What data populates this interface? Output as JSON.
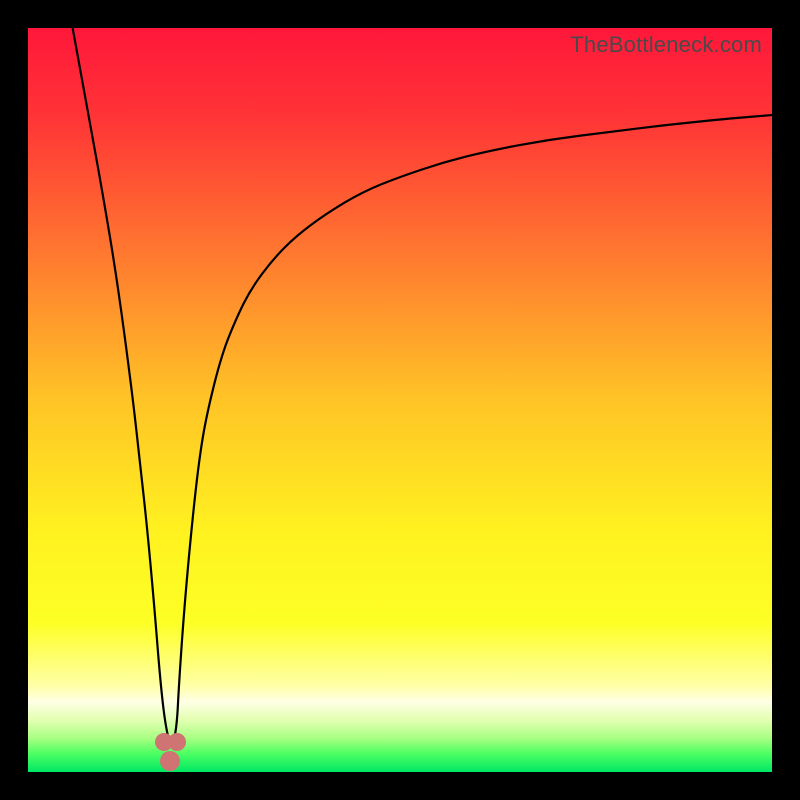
{
  "watermark": "TheBottleneck.com",
  "chart_data": {
    "type": "line",
    "title": "",
    "xlabel": "",
    "ylabel": "",
    "xlim": [
      0,
      100
    ],
    "ylim": [
      0,
      100
    ],
    "axes_visible": false,
    "background_gradient": {
      "stops": [
        {
          "pos": 0.0,
          "color": "#ff173a"
        },
        {
          "pos": 0.12,
          "color": "#ff3436"
        },
        {
          "pos": 0.3,
          "color": "#ff7730"
        },
        {
          "pos": 0.5,
          "color": "#ffc426"
        },
        {
          "pos": 0.68,
          "color": "#fff220"
        },
        {
          "pos": 0.8,
          "color": "#fdff25"
        },
        {
          "pos": 0.885,
          "color": "#ffffa9"
        },
        {
          "pos": 0.905,
          "color": "#ffffe6"
        },
        {
          "pos": 0.93,
          "color": "#e3ffb1"
        },
        {
          "pos": 0.955,
          "color": "#a7ff82"
        },
        {
          "pos": 0.975,
          "color": "#4dff62"
        },
        {
          "pos": 1.0,
          "color": "#00e765"
        }
      ]
    },
    "series": [
      {
        "name": "bottleneck-curve",
        "stroke": "#000000",
        "stroke_width": 2.2,
        "x": [
          6,
          8,
          10,
          12,
          14,
          15,
          16,
          17,
          17.8,
          18.5,
          19.3,
          20,
          20.3,
          21,
          22,
          23,
          24,
          26,
          28,
          30,
          33,
          36,
          40,
          45,
          50,
          56,
          62,
          70,
          78,
          86,
          94,
          100
        ],
        "y": [
          100,
          89,
          78,
          66,
          51,
          42,
          33,
          22,
          12,
          6,
          3,
          6,
          12,
          22,
          33,
          42,
          48,
          56,
          61,
          65,
          69,
          72,
          75,
          78,
          80,
          82,
          83.5,
          85,
          86,
          87,
          87.8,
          88.3
        ]
      }
    ],
    "markers": [
      {
        "name": "valley-left",
        "x": 18.3,
        "y": 4,
        "color": "#cf7373",
        "size": 18
      },
      {
        "name": "valley-right",
        "x": 20.0,
        "y": 4,
        "color": "#cf7373",
        "size": 18
      },
      {
        "name": "valley-bottom",
        "x": 19.1,
        "y": 1.5,
        "color": "#cf7373",
        "size": 20
      }
    ]
  }
}
